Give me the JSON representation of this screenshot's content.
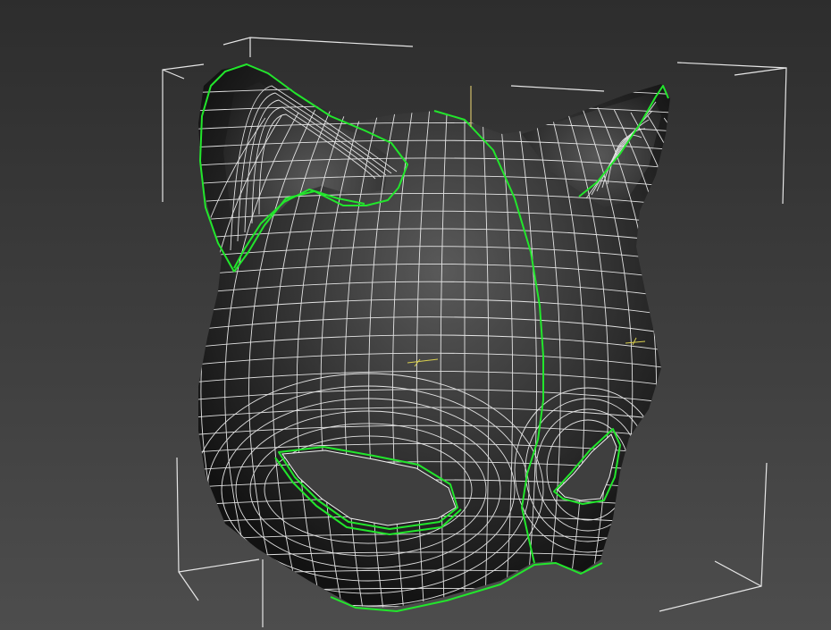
{
  "viewport": {
    "background_top": "#2d2d2d",
    "background_bottom": "#4d4d4d",
    "mesh_fill_center": "#5a5a5a",
    "mesh_fill_mid": "#333333",
    "mesh_fill_edge": "#121212",
    "wire_color": "#f2f2f2",
    "seam_color": "#22e62c",
    "bbox_color": "#e6e6e6",
    "pivot_color": "#d2bf6a",
    "gizmo_color": "#d9cf4e"
  }
}
